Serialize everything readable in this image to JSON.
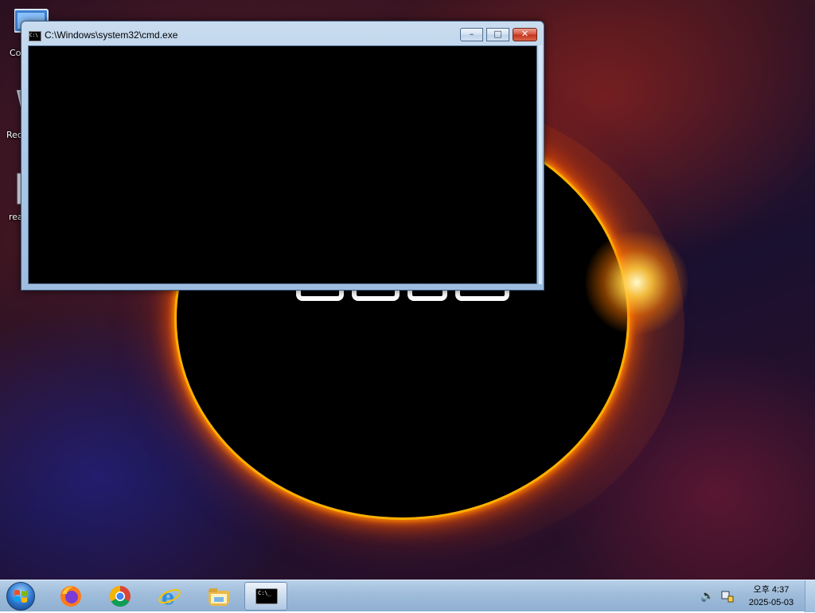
{
  "window": {
    "title": "C:\\Windows\\system32\\cmd.exe",
    "icon": "console-icon",
    "buttons": {
      "minimize": "–",
      "maximize": "□",
      "close": "✕"
    }
  },
  "desktop_icons": [
    {
      "label": "Co",
      "icon": "computer-icon"
    },
    {
      "label": "Rec",
      "icon": "recycle-bin-icon"
    },
    {
      "label": "rea",
      "icon": "document-icon"
    }
  ],
  "taskbar": {
    "apps": [
      {
        "name": "firefox",
        "icon": "firefox-icon"
      },
      {
        "name": "chrome",
        "icon": "chrome-icon"
      },
      {
        "name": "internet-explorer",
        "icon": "internet-explorer-icon"
      },
      {
        "name": "file-explorer",
        "icon": "folder-icon"
      },
      {
        "name": "cmd",
        "icon": "console-icon",
        "active": true,
        "glyph_text": "C:\\_"
      }
    ],
    "tray": {
      "volume_glyph": "🔊"
    },
    "clock": {
      "time": "오후 4:37",
      "date": "2025-05-03"
    }
  },
  "colors": {
    "taskbar": "#9fbcda",
    "console_bg": "#000000",
    "close_button": "#c4321c",
    "eclipse_glow": "#ff8a00"
  }
}
